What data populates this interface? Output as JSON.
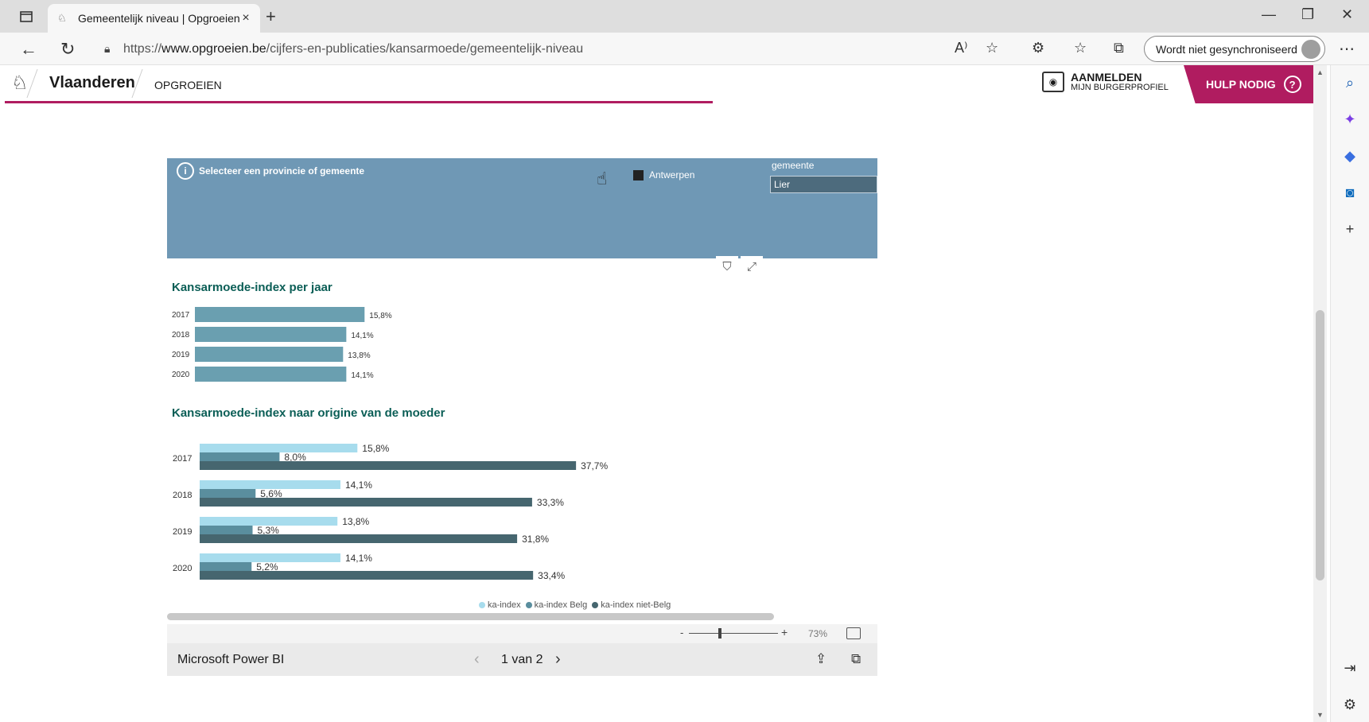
{
  "browser": {
    "tab_title": "Gemeentelijk niveau | Opgroeien",
    "url_prefix": "https://",
    "url_host": "www.opgroeien.be",
    "url_path": "/cijfers-en-publicaties/kansarmoede/gemeentelijk-niveau",
    "sync_label": "Wordt niet gesynchroniseerd"
  },
  "site": {
    "brand": "Vlaanderen",
    "sub_brand": "OPGROEIEN",
    "login_line1": "AANMELDEN",
    "login_line2": "MIJN BURGERPROFIEL",
    "help_label": "HULP NODIG"
  },
  "report": {
    "slicer_info": "Selecteer een provincie of gemeente",
    "province": "Antwerpen",
    "gemeente_label": "gemeente",
    "gemeente_value": "Lier",
    "zoom": "73%",
    "footer_brand": "Microsoft Power BI",
    "pager": "1 van 2"
  },
  "colors": {
    "accent": "#b01c60",
    "slicer_bg": "#6f98b5",
    "bar_primary": "#6a9fb0",
    "ka_index": "#a7dced",
    "ka_index_belg": "#5a8e9e",
    "ka_index_niet_belg": "#46666f",
    "title_green": "#0b5e56"
  },
  "chart_data": [
    {
      "type": "bar",
      "title": "Kansarmoede-index per jaar",
      "orientation": "horizontal",
      "categories": [
        "2017",
        "2018",
        "2019",
        "2020"
      ],
      "values": [
        15.8,
        14.1,
        13.8,
        14.1
      ],
      "labels": [
        "15,8%",
        "14,1%",
        "13,8%",
        "14,1%"
      ],
      "xlim": [
        0,
        40
      ]
    },
    {
      "type": "bar",
      "title": "Kansarmoede-index naar origine van de moeder",
      "orientation": "horizontal",
      "categories": [
        "2017",
        "2018",
        "2019",
        "2020"
      ],
      "series": [
        {
          "name": "ka-index",
          "values": [
            15.8,
            14.1,
            13.8,
            14.1
          ],
          "labels": [
            "15,8%",
            "14,1%",
            "13,8%",
            "14,1%"
          ]
        },
        {
          "name": "ka-index Belg",
          "values": [
            8.0,
            5.6,
            5.3,
            5.2
          ],
          "labels": [
            "8,0%",
            "5,6%",
            "5,3%",
            "5,2%"
          ]
        },
        {
          "name": "ka-index niet-Belg",
          "values": [
            37.7,
            33.3,
            31.8,
            33.4
          ],
          "labels": [
            "37,7%",
            "33,3%",
            "31,8%",
            "33,4%"
          ]
        }
      ],
      "xlim": [
        0,
        40
      ],
      "legend": "bottom"
    }
  ]
}
